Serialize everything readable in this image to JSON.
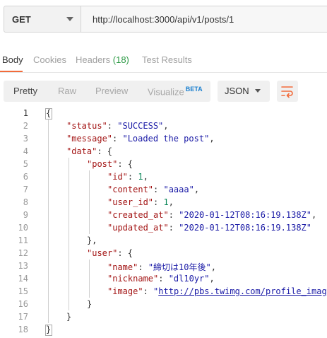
{
  "request": {
    "method": "GET",
    "url": "http://localhost:3000/api/v1/posts/1"
  },
  "response_tabs": [
    {
      "label": "Body"
    },
    {
      "label": "Cookies"
    },
    {
      "label": "Headers",
      "count": "(18)"
    },
    {
      "label": "Test Results"
    }
  ],
  "view_modes": {
    "pretty": "Pretty",
    "raw": "Raw",
    "preview": "Preview",
    "visualize": "Visualize",
    "visualize_badge": "BETA"
  },
  "format": "JSON",
  "icons": {
    "method_dropdown": "chevron-down-icon",
    "format_dropdown": "chevron-down-icon",
    "wrap": "wrap-lines-icon"
  },
  "colors": {
    "accent": "#f26b3a",
    "count_green": "#2d9a45",
    "beta_blue": "#1a7fcf",
    "json_key": "#a31515",
    "json_string": "#1a1aa6",
    "json_number": "#098658"
  },
  "code_lines": [
    {
      "num": "1",
      "tokens": [
        {
          "t": "{",
          "c": "p"
        }
      ]
    },
    {
      "num": "2",
      "tokens": [
        {
          "t": "\"status\"",
          "c": "k"
        },
        {
          "t": ": ",
          "c": "p"
        },
        {
          "t": "\"SUCCESS\"",
          "c": "s"
        },
        {
          "t": ",",
          "c": "p"
        }
      ]
    },
    {
      "num": "3",
      "tokens": [
        {
          "t": "\"message\"",
          "c": "k"
        },
        {
          "t": ": ",
          "c": "p"
        },
        {
          "t": "\"Loaded the post\"",
          "c": "s"
        },
        {
          "t": ",",
          "c": "p"
        }
      ]
    },
    {
      "num": "4",
      "tokens": [
        {
          "t": "\"data\"",
          "c": "k"
        },
        {
          "t": ": {",
          "c": "p"
        }
      ]
    },
    {
      "num": "5",
      "tokens": [
        {
          "t": "\"post\"",
          "c": "k"
        },
        {
          "t": ": {",
          "c": "p"
        }
      ]
    },
    {
      "num": "6",
      "tokens": [
        {
          "t": "\"id\"",
          "c": "k"
        },
        {
          "t": ": ",
          "c": "p"
        },
        {
          "t": "1",
          "c": "n"
        },
        {
          "t": ",",
          "c": "p"
        }
      ]
    },
    {
      "num": "7",
      "tokens": [
        {
          "t": "\"content\"",
          "c": "k"
        },
        {
          "t": ": ",
          "c": "p"
        },
        {
          "t": "\"aaaa\"",
          "c": "s"
        },
        {
          "t": ",",
          "c": "p"
        }
      ]
    },
    {
      "num": "8",
      "tokens": [
        {
          "t": "\"user_id\"",
          "c": "k"
        },
        {
          "t": ": ",
          "c": "p"
        },
        {
          "t": "1",
          "c": "n"
        },
        {
          "t": ",",
          "c": "p"
        }
      ]
    },
    {
      "num": "9",
      "tokens": [
        {
          "t": "\"created_at\"",
          "c": "k"
        },
        {
          "t": ": ",
          "c": "p"
        },
        {
          "t": "\"2020-01-12T08:16:19.138Z\"",
          "c": "s"
        },
        {
          "t": ",",
          "c": "p"
        }
      ]
    },
    {
      "num": "10",
      "tokens": [
        {
          "t": "\"updated_at\"",
          "c": "k"
        },
        {
          "t": ": ",
          "c": "p"
        },
        {
          "t": "\"2020-01-12T08:16:19.138Z\"",
          "c": "s"
        }
      ]
    },
    {
      "num": "11",
      "tokens": [
        {
          "t": "},",
          "c": "p"
        }
      ]
    },
    {
      "num": "12",
      "tokens": [
        {
          "t": "\"user\"",
          "c": "k"
        },
        {
          "t": ": {",
          "c": "p"
        }
      ]
    },
    {
      "num": "13",
      "tokens": [
        {
          "t": "\"name\"",
          "c": "k"
        },
        {
          "t": ": ",
          "c": "p"
        },
        {
          "t": "\"締切は10年後\"",
          "c": "s"
        },
        {
          "t": ",",
          "c": "p"
        }
      ]
    },
    {
      "num": "14",
      "tokens": [
        {
          "t": "\"nickname\"",
          "c": "k"
        },
        {
          "t": ": ",
          "c": "p"
        },
        {
          "t": "\"dl10yr\"",
          "c": "s"
        },
        {
          "t": ",",
          "c": "p"
        }
      ]
    },
    {
      "num": "15",
      "tokens": [
        {
          "t": "\"image\"",
          "c": "k"
        },
        {
          "t": ": ",
          "c": "p"
        },
        {
          "t": "\"",
          "c": "s"
        },
        {
          "t": "http://pbs.twimg.com/profile_imag",
          "c": "link"
        }
      ]
    },
    {
      "num": "16",
      "tokens": [
        {
          "t": "}",
          "c": "p"
        }
      ]
    },
    {
      "num": "17",
      "tokens": [
        {
          "t": "}",
          "c": "p"
        }
      ]
    },
    {
      "num": "18",
      "tokens": [
        {
          "t": "}",
          "c": "p"
        }
      ]
    }
  ]
}
